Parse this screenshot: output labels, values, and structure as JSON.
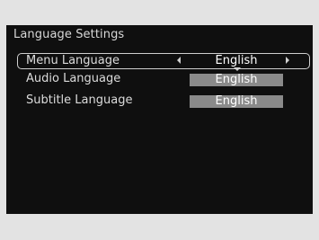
{
  "screen": {
    "title": "Language Settings",
    "rows": [
      {
        "label": "Menu Language",
        "value": "English",
        "selected": true
      },
      {
        "label": "Audio Language",
        "value": "English",
        "selected": false
      },
      {
        "label": "Subtitle Language",
        "value": "English",
        "selected": false
      }
    ]
  },
  "colors": {
    "screen_background": "#0f0f0f",
    "value_field": "#8a8a8a",
    "frame": "#e3e3e3"
  },
  "icons": [
    "left-arrow-icon",
    "right-arrow-icon",
    "caret-down-icon"
  ]
}
